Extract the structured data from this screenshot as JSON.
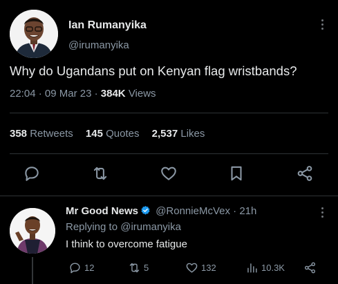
{
  "tweet": {
    "author_name": "Ian Rumanyika",
    "author_handle": "@irumanyika",
    "text": "Why do Ugandans put on Kenyan flag wristbands?",
    "time": "22:04",
    "date": "09 Mar 23",
    "views_count": "384K",
    "views_label": "Views",
    "separator": "·"
  },
  "stats": {
    "retweets_count": "358",
    "retweets_label": "Retweets",
    "quotes_count": "145",
    "quotes_label": "Quotes",
    "likes_count": "2,537",
    "likes_label": "Likes"
  },
  "actions": {
    "icons": [
      "reply-icon",
      "retweet-icon",
      "like-icon",
      "bookmark-icon",
      "share-icon"
    ]
  },
  "reply": {
    "author_name": "Mr Good News",
    "verified_color": "#1d9bf0",
    "author_handle": "@RonnieMcVex",
    "age": "21h",
    "separator": "·",
    "replying_prefix": "Replying to",
    "replying_to": "@irumanyika",
    "text": "I think to overcome fatigue",
    "reply_count": "12",
    "retweet_count": "5",
    "like_count": "132",
    "views_count": "10.3K"
  }
}
